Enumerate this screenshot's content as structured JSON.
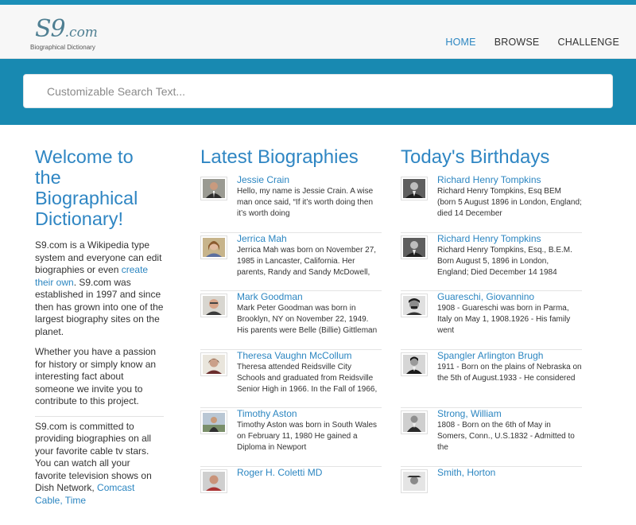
{
  "header": {
    "logo_text": "S9",
    "logo_domain": ".com",
    "logo_tagline": "Biographical Dictionary",
    "nav": [
      {
        "label": "HOME",
        "active": true
      },
      {
        "label": "BROWSE",
        "active": false
      },
      {
        "label": "CHALLENGE",
        "active": false
      }
    ]
  },
  "search": {
    "placeholder": "Customizable Search Text..."
  },
  "welcome": {
    "title": "Welcome to the Biographical Dictionary!",
    "p1_before": "S9.com is a Wikipedia type system and everyone can edit biographies or even ",
    "p1_link": "create their own",
    "p1_after": ". S9.com was established in 1997 and since then has grown into one of the largest biography sites on the planet.",
    "p2": "Whether you have a passion for history or simply know an interesting fact about someone we invite you to contribute to this project.",
    "p3_before": "S9.com is committed to providing biographies on all your favorite cable tv stars. You can watch all your favorite television shows on Dish Network, ",
    "p3_link": "Comcast Cable, Time"
  },
  "latest": {
    "title": "Latest Biographies",
    "items": [
      {
        "name": "Jessie Crain",
        "text": "Hello, my name is Jessie Crain. A wise man once said, “If it’s worth doing then it’s worth doing"
      },
      {
        "name": "Jerrica Mah",
        "text": "Jerrica Mah was born on November 27, 1985 in Lancaster, California. Her parents, Randy and Sandy McDowell, are"
      },
      {
        "name": "Mark Goodman",
        "text": "Mark Peter Goodman was born in Brooklyn, NY on November 22, 1949. His parents were Belle (Billie) Gittleman"
      },
      {
        "name": "Theresa Vaughn McCollum",
        "text": "Theresa attended Reidsville City Schools and graduated from Reidsville Senior High in 1966.  In the Fall of 1966,"
      },
      {
        "name": "Timothy Aston",
        "text": "Timothy Aston was born in South Wales on February 11, 1980 He gained a Diploma in Newport"
      },
      {
        "name": "Roger H. Coletti MD",
        "text": ""
      }
    ]
  },
  "birthdays": {
    "title": "Today's Birthdays",
    "items": [
      {
        "name": "Richard Henry Tompkins",
        "text": "Richard Henry Tompkins, Esq BEM (born 5 August 1896 in London, England; died 14 December"
      },
      {
        "name": "Richard Henry Tompkins",
        "text": "Richard Henry Tompkins, Esq., B.E.M. Born August 5, 1896 in London, England; Died December 14 1984"
      },
      {
        "name": "Guareschi, Giovannino",
        "text": "1908 - Guareschi was born in Parma, Italy on May 1, 1908.1926 - His family went"
      },
      {
        "name": "Spangler Arlington Brugh",
        "text": "1911 - Born on the plains of Nebraska on the 5th of August.1933 - He considered"
      },
      {
        "name": "Strong, William",
        "text": "1808 - Born on the 6th of May in Somers, Conn., U.S.1832 - Admitted to the"
      },
      {
        "name": "Smith, Horton",
        "text": ""
      }
    ]
  },
  "colors": {
    "accent": "#1889b1",
    "link": "#2c86c1",
    "title": "#2f86c3"
  }
}
